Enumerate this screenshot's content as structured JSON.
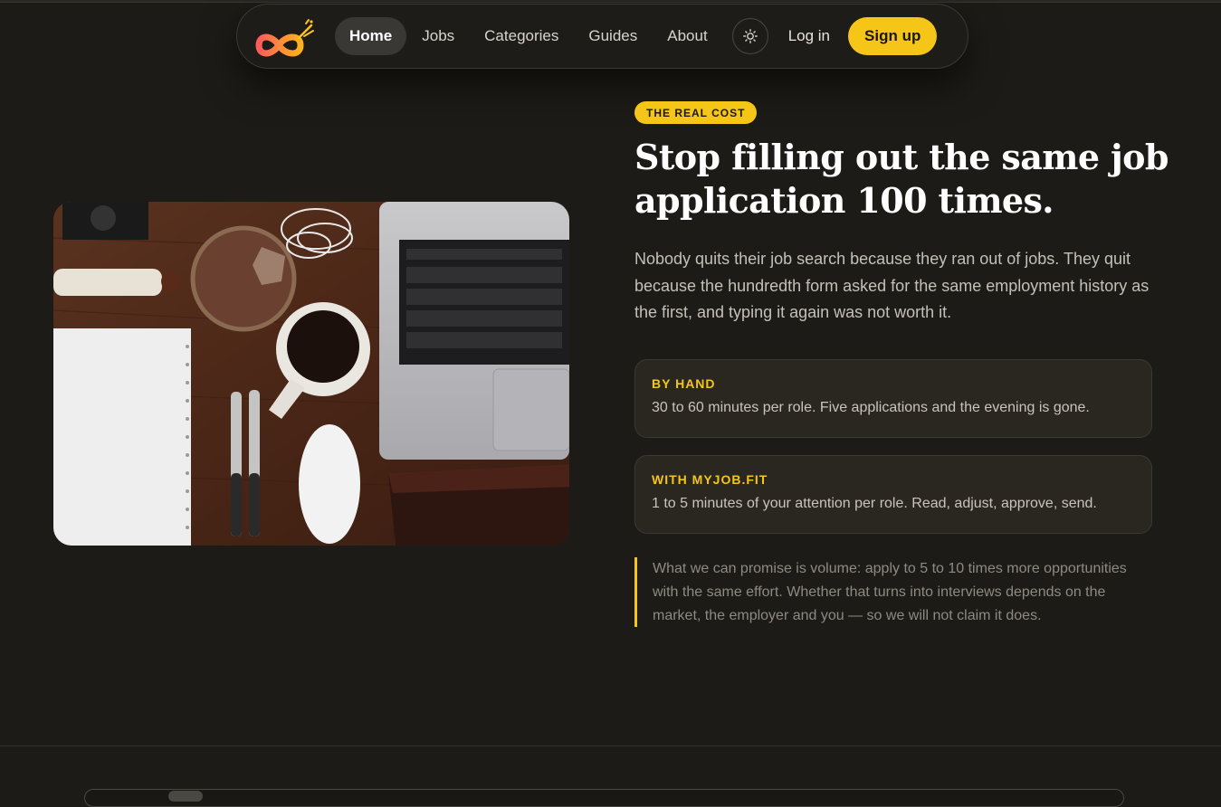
{
  "nav": {
    "links": [
      "Home",
      "Jobs",
      "Categories",
      "Guides",
      "About"
    ],
    "active": "Home",
    "login_label": "Log in",
    "signup_label": "Sign up",
    "theme_icon": "sun-icon"
  },
  "hero": {
    "badge": "THE REAL COST",
    "headline_line1": "Stop filling out the same job",
    "headline_line2": "application 100 times.",
    "lead": "Nobody quits their job search because they ran out of jobs. They quit because the hundredth form asked for the same employment history as the first, and typing it again was not worth it.",
    "cards": [
      {
        "title": "BY HAND",
        "body": "30 to 60 minutes per role. Five applications and the evening is gone."
      },
      {
        "title": "WITH MYJOB.FIT",
        "body": "1 to 5 minutes of your attention per role. Read, adjust, approve, send."
      }
    ],
    "quote": "What we can promise is volume: apply to 5 to 10 times more opportunities with the same effort. Whether that turns into interviews depends on the market, the employer and you — so we will not claim it does."
  },
  "colors": {
    "accent": "#f5c518",
    "background": "#1d1b17",
    "card_bg": "#2a2721"
  }
}
